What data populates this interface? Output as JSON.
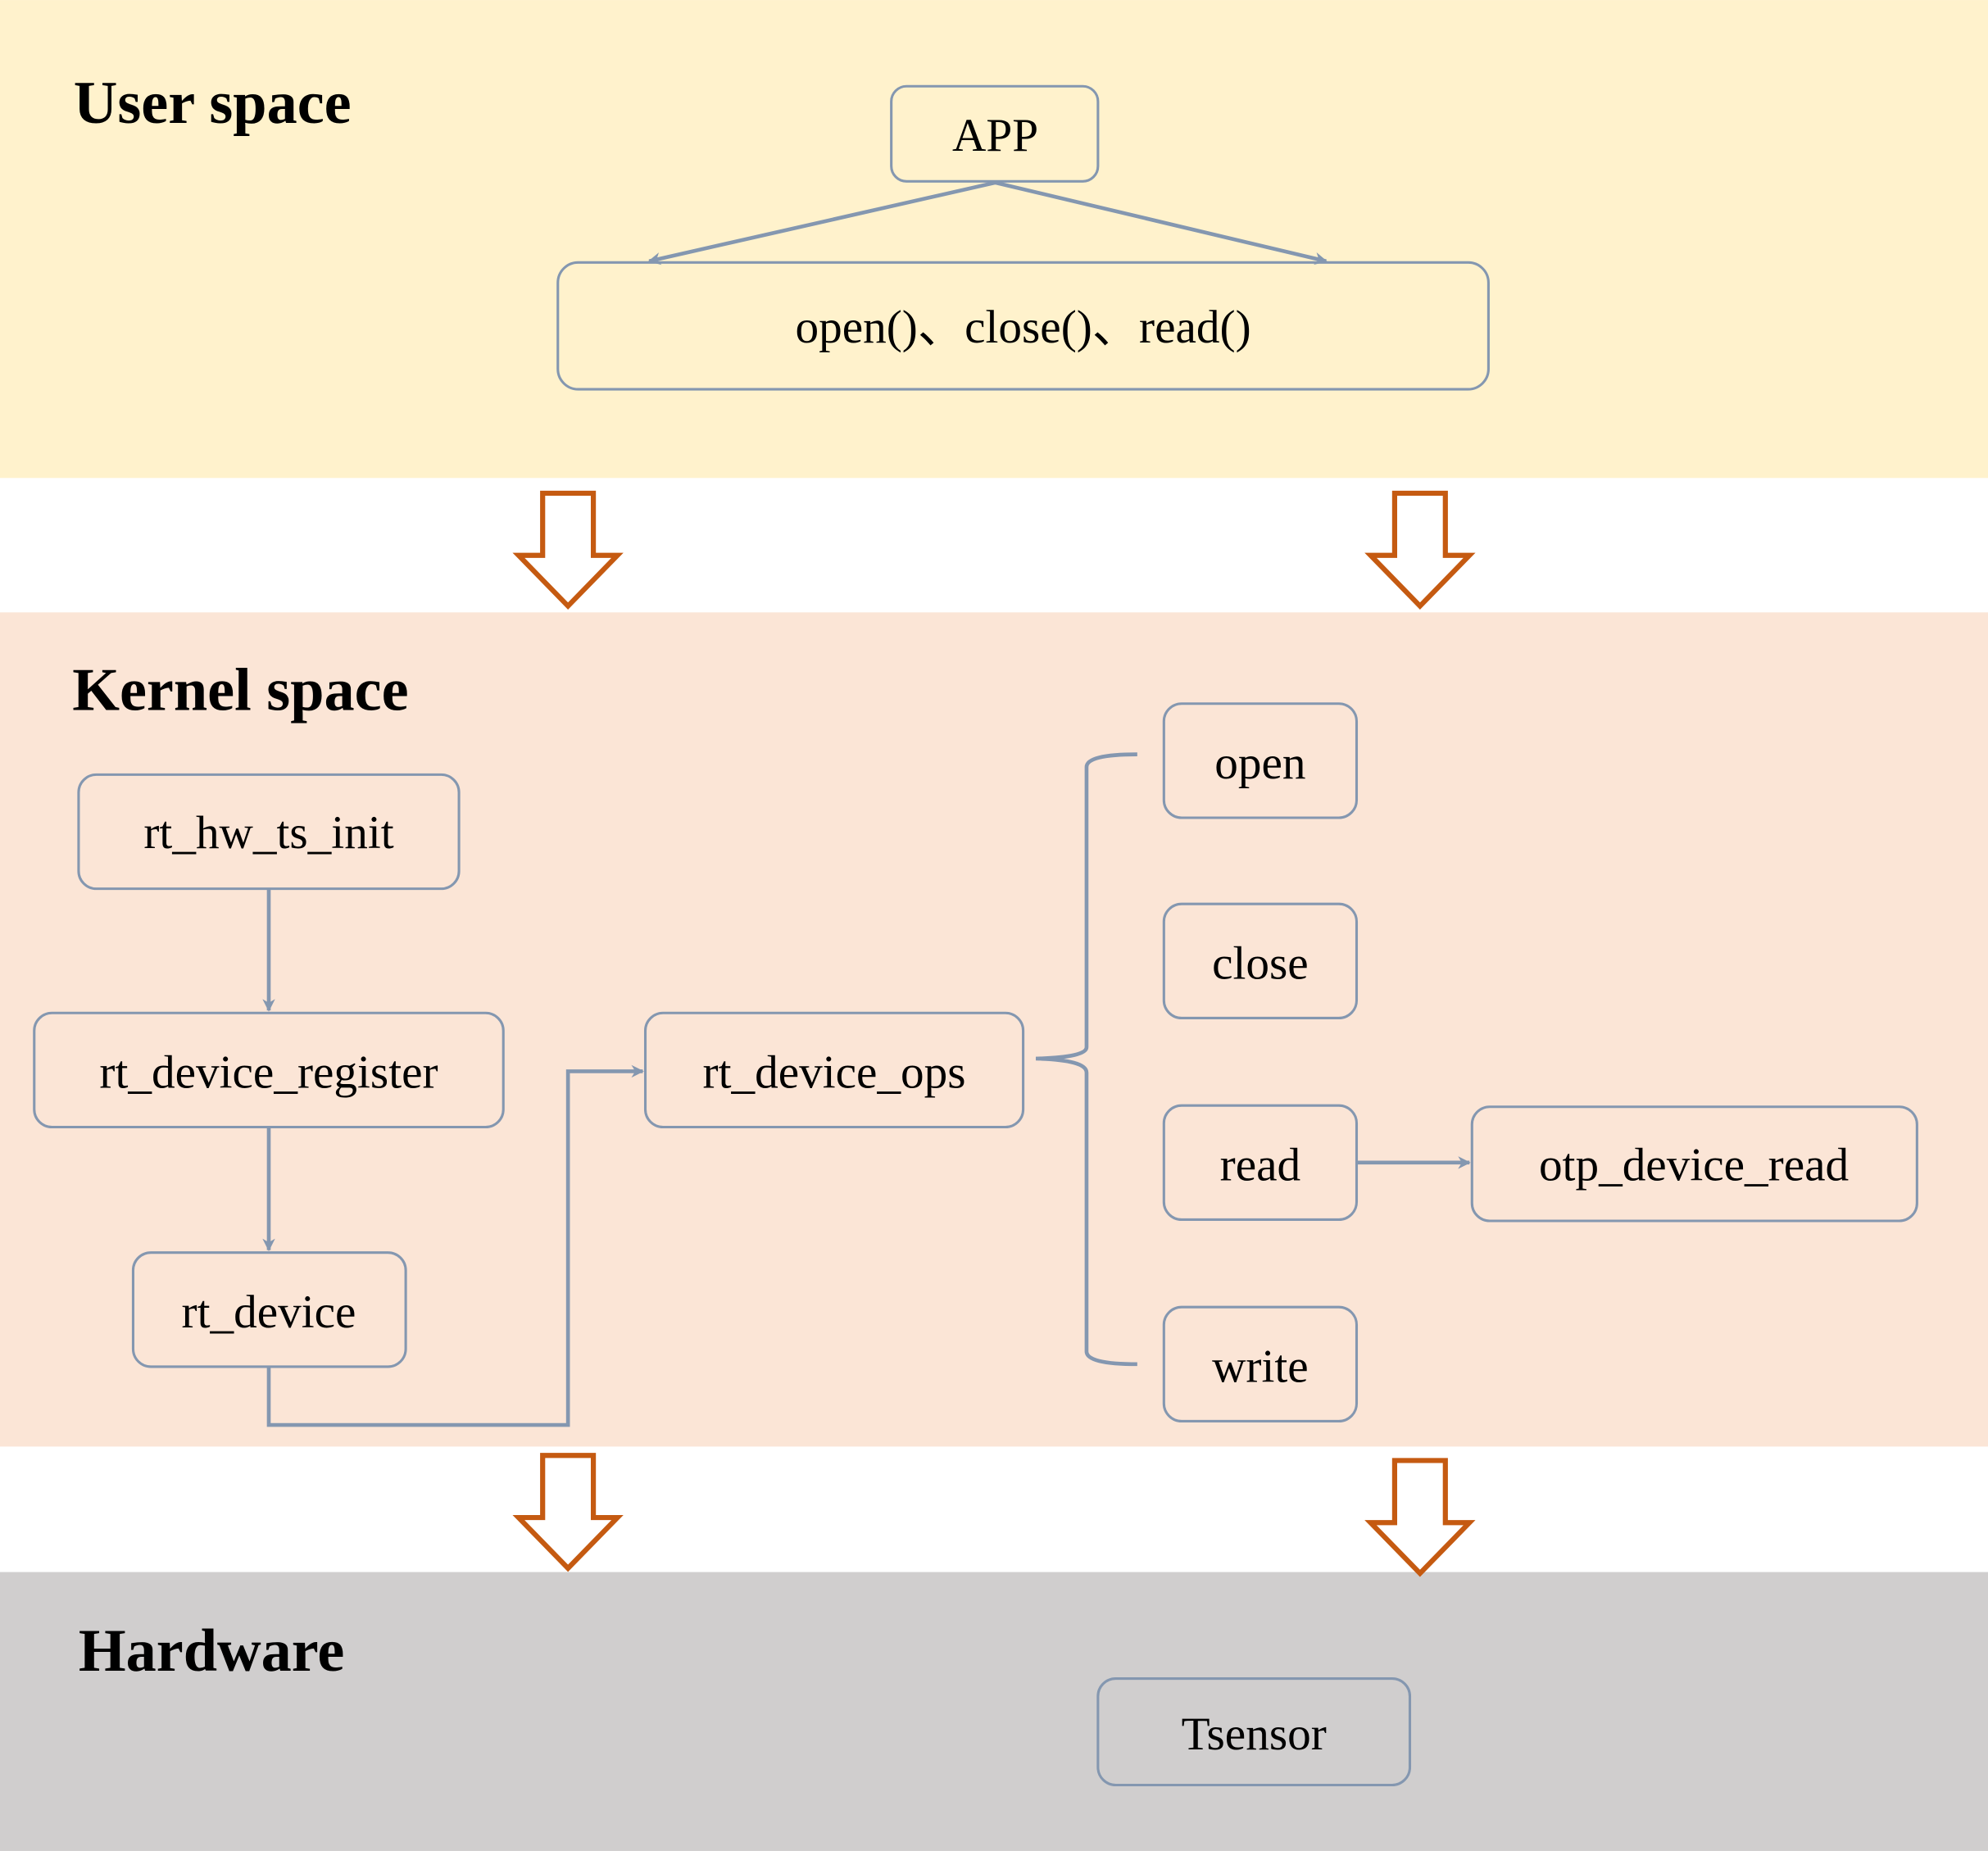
{
  "colors": {
    "user_band": "#FFF2CC",
    "kernel_band": "#FBE5D6",
    "hardware_band": "#D0CECE",
    "node_border": "#8497B0",
    "connector": "#8497B0",
    "layer_arrow": "#C55A11"
  },
  "bands": {
    "user": {
      "title": "User space"
    },
    "kernel": {
      "title": "Kernel space"
    },
    "hardware": {
      "title": "Hardware"
    }
  },
  "nodes": {
    "app": "APP",
    "syscalls": "open()、close()、read()",
    "rt_hw_ts_init": "rt_hw_ts_init",
    "rt_device_register": "rt_device_register",
    "rt_device": "rt_device",
    "rt_device_ops": "rt_device_ops",
    "open": "open",
    "close": "close",
    "read": "read",
    "write": "write",
    "otp_device_read": "otp_device_read",
    "tsensor": "Tsensor"
  },
  "edges": [
    {
      "from": "app",
      "to": "syscalls",
      "label": ""
    },
    {
      "from": "rt_hw_ts_init",
      "to": "rt_device_register",
      "label": ""
    },
    {
      "from": "rt_device_register",
      "to": "rt_device",
      "label": ""
    },
    {
      "from": "rt_device",
      "to": "rt_device_ops",
      "label": ""
    },
    {
      "from": "rt_device_ops",
      "to": [
        "open",
        "close",
        "read",
        "write"
      ],
      "label": "brace"
    },
    {
      "from": "read",
      "to": "otp_device_read",
      "label": ""
    }
  ]
}
